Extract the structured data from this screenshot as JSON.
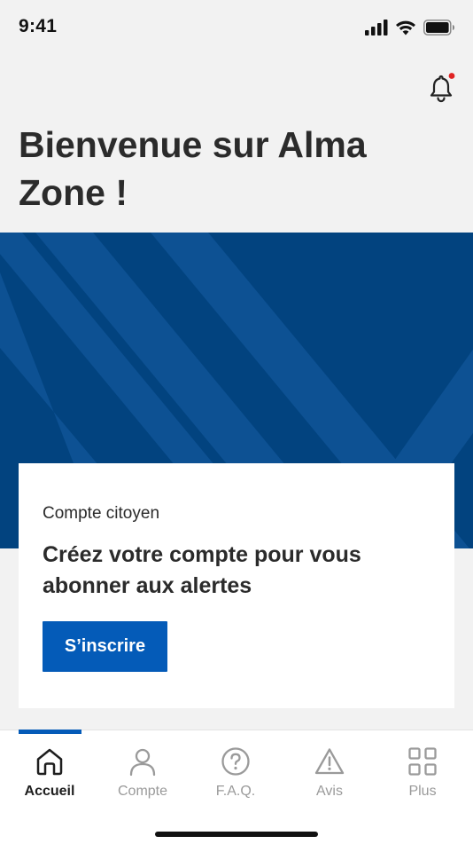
{
  "status_bar": {
    "time": "9:41",
    "icons": [
      "cellular-signal-icon",
      "wifi-icon",
      "battery-icon"
    ]
  },
  "header": {
    "notification_icon": "bell-icon",
    "has_unread_notification": true,
    "title": "Bienvenue sur Alma Zone !"
  },
  "hero": {
    "background_color": "#02437f",
    "stripe_color": "#0d5193"
  },
  "signup_card": {
    "eyebrow": "Compte citoyen",
    "heading": "Créez votre compte pour vous abonner aux alertes",
    "button_label": "S’inscrire",
    "button_color": "#045bb8"
  },
  "tab_bar": {
    "active_index": 0,
    "tabs": [
      {
        "label": "Accueil",
        "icon": "home-icon"
      },
      {
        "label": "Compte",
        "icon": "user-icon"
      },
      {
        "label": "F.A.Q.",
        "icon": "question-circle-icon"
      },
      {
        "label": "Avis",
        "icon": "warning-triangle-icon"
      },
      {
        "label": "Plus",
        "icon": "grid-icon"
      }
    ]
  },
  "colors": {
    "accent": "#045bb8",
    "notification_dot": "#e02424",
    "page_background": "#f2f2f2"
  }
}
